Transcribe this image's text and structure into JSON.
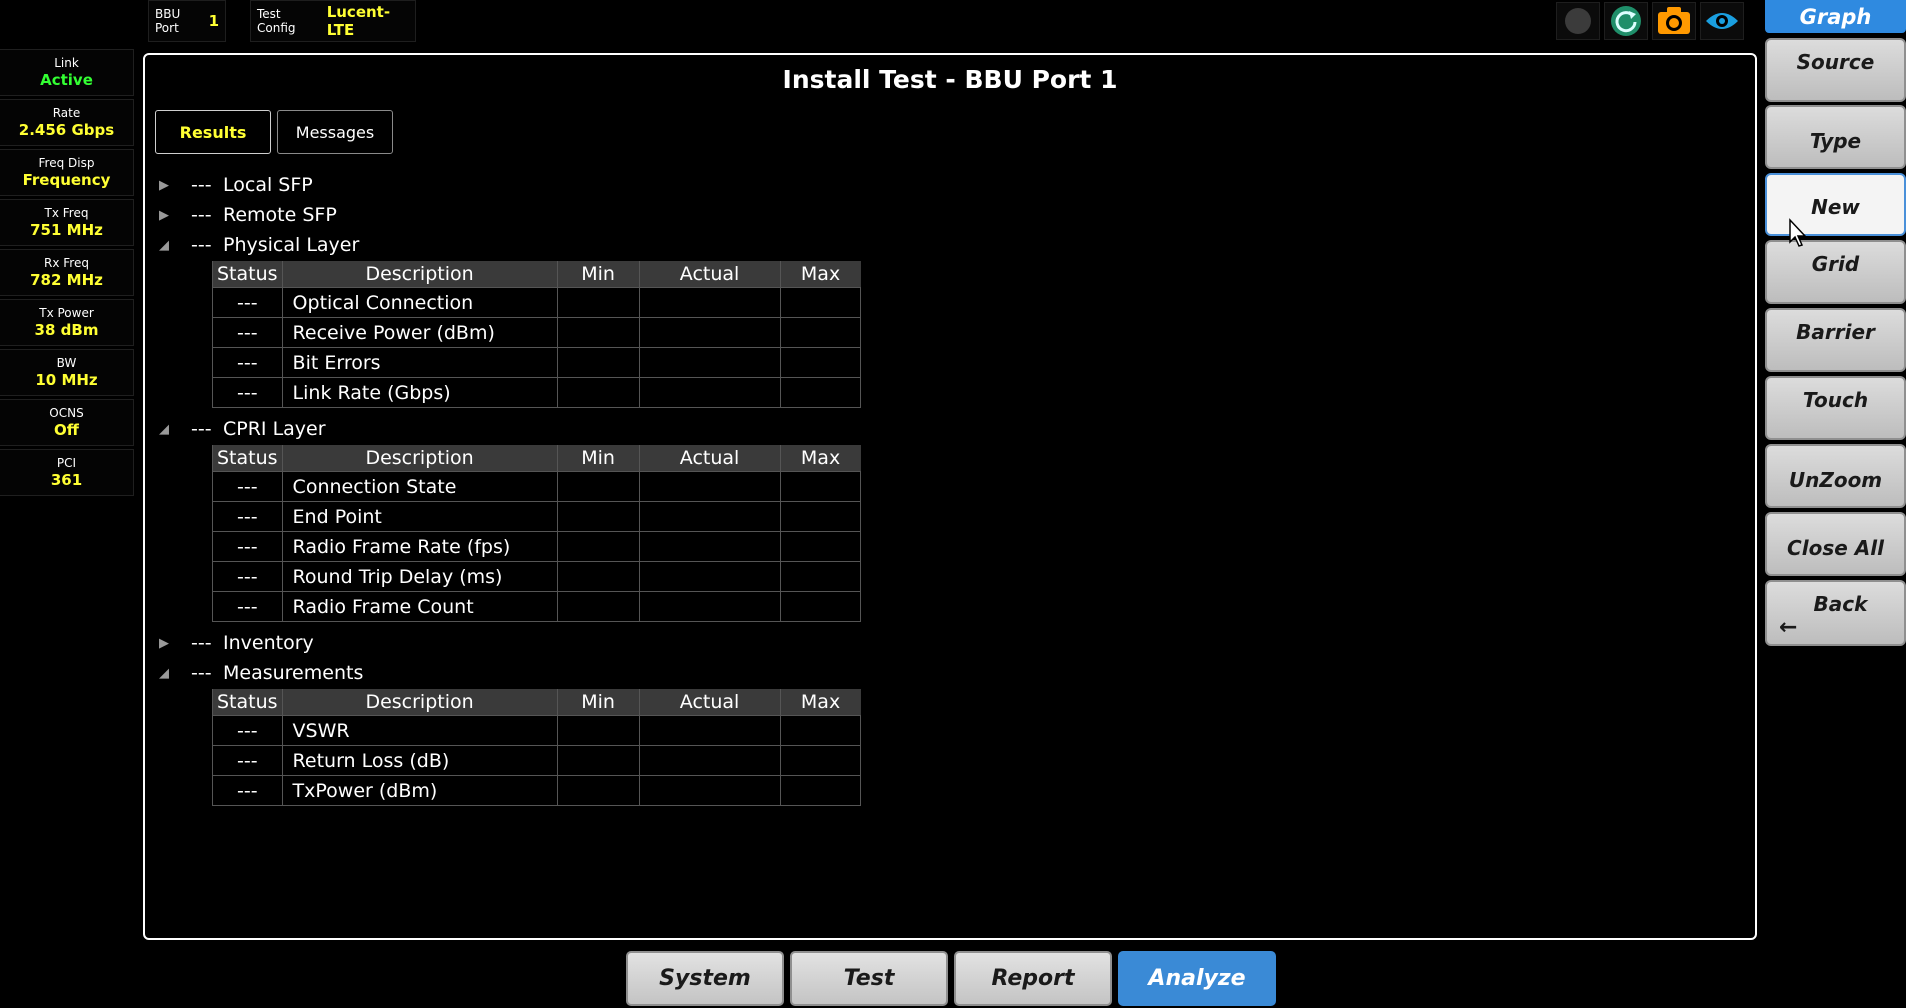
{
  "top_bar": {
    "bbu_port_label": "BBU Port",
    "bbu_port_value": "1",
    "test_config_label": "Test Config",
    "test_config_value": "Lucent-LTE"
  },
  "left_panel": [
    {
      "label": "Link",
      "value": "Active"
    },
    {
      "label": "Rate",
      "value": "2.456 Gbps"
    },
    {
      "label": "Freq Disp",
      "value": "Frequency"
    },
    {
      "label": "Tx Freq",
      "value": "751 MHz"
    },
    {
      "label": "Rx Freq",
      "value": "782 MHz"
    },
    {
      "label": "Tx Power",
      "value": "38 dBm"
    },
    {
      "label": "BW",
      "value": "10 MHz"
    },
    {
      "label": "OCNS",
      "value": "Off"
    },
    {
      "label": "PCI",
      "value": "361"
    }
  ],
  "main": {
    "title": "Install Test - BBU Port 1",
    "tabs": [
      "Results",
      "Messages"
    ],
    "table_headers": [
      "Status",
      "Description",
      "Min",
      "Actual",
      "Max"
    ],
    "sections": [
      {
        "dash": "---",
        "name": "Local SFP",
        "expanded": false,
        "rows": []
      },
      {
        "dash": "---",
        "name": "Remote SFP",
        "expanded": false,
        "rows": []
      },
      {
        "dash": "---",
        "name": "Physical Layer",
        "expanded": true,
        "rows": [
          {
            "status": "---",
            "description": "Optical Connection",
            "min": "",
            "actual": "",
            "max": ""
          },
          {
            "status": "---",
            "description": "Receive Power (dBm)",
            "min": "",
            "actual": "",
            "max": ""
          },
          {
            "status": "---",
            "description": "Bit Errors",
            "min": "",
            "actual": "",
            "max": ""
          },
          {
            "status": "---",
            "description": "Link Rate (Gbps)",
            "min": "",
            "actual": "",
            "max": ""
          }
        ]
      },
      {
        "dash": "---",
        "name": "CPRI Layer",
        "expanded": true,
        "rows": [
          {
            "status": "---",
            "description": "Connection State",
            "min": "",
            "actual": "",
            "max": ""
          },
          {
            "status": "---",
            "description": "End Point",
            "min": "",
            "actual": "",
            "max": ""
          },
          {
            "status": "---",
            "description": "Radio Frame Rate (fps)",
            "min": "",
            "actual": "",
            "max": ""
          },
          {
            "status": "---",
            "description": "Round Trip Delay (ms)",
            "min": "",
            "actual": "",
            "max": ""
          },
          {
            "status": "---",
            "description": "Radio Frame Count",
            "min": "",
            "actual": "",
            "max": ""
          }
        ]
      },
      {
        "dash": "---",
        "name": "Inventory",
        "expanded": false,
        "rows": []
      },
      {
        "dash": "---",
        "name": "Measurements",
        "expanded": true,
        "rows": [
          {
            "status": "---",
            "description": "VSWR",
            "min": "",
            "actual": "",
            "max": ""
          },
          {
            "status": "---",
            "description": "Return Loss (dB)",
            "min": "",
            "actual": "",
            "max": ""
          },
          {
            "status": "---",
            "description": "TxPower (dBm)",
            "min": "",
            "actual": "",
            "max": ""
          }
        ]
      }
    ]
  },
  "right_panel": {
    "header": "Graph",
    "buttons": [
      "Source",
      "Type",
      "New",
      "Grid",
      "Barrier",
      "Touch",
      "UnZoom",
      "Close All",
      "Back"
    ],
    "selected": "New"
  },
  "bottom_nav": {
    "buttons": [
      "System",
      "Test",
      "Report",
      "Analyze"
    ],
    "active": "Analyze"
  },
  "colors": {
    "highlight_yellow": "#ffff33",
    "active_green": "#33ff33",
    "accent_blue": "#3a8ad6",
    "camera_orange": "#ff9900",
    "eye_blue": "#1a9fe0",
    "refresh_teal": "#1f8f6a"
  },
  "icons": [
    "record-icon",
    "refresh-icon",
    "camera-icon",
    "eye-icon"
  ]
}
